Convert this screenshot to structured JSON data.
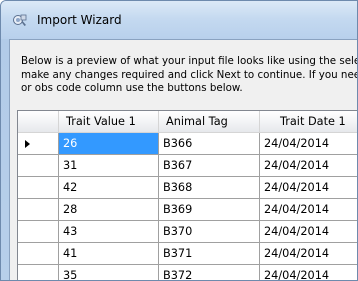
{
  "window": {
    "title": "Import Wizard"
  },
  "instructions": {
    "line1": "Below is a preview of what your input file looks like using the selected",
    "line2": "make any changes required and click Next to continue. If you need to",
    "line3": "or obs code column use the buttons below."
  },
  "grid": {
    "columns": [
      "Trait Value 1",
      "Animal Tag",
      "Trait Date 1"
    ],
    "rows": [
      [
        "26",
        "B366",
        "24/04/2014"
      ],
      [
        "31",
        "B367",
        "24/04/2014"
      ],
      [
        "42",
        "B368",
        "24/04/2014"
      ],
      [
        "28",
        "B369",
        "24/04/2014"
      ],
      [
        "43",
        "B370",
        "24/04/2014"
      ],
      [
        "41",
        "B371",
        "24/04/2014"
      ],
      [
        "35",
        "B372",
        "24/04/2014"
      ]
    ],
    "selected_cell": "row 1, Trait Value 1",
    "current_row_indicator": "triangle-right-icon"
  },
  "colors": {
    "selection": "#3399ff",
    "window_frame": "#b7cfea",
    "client_bg": "#f0f0f0",
    "grid_bg": "#ababab"
  }
}
